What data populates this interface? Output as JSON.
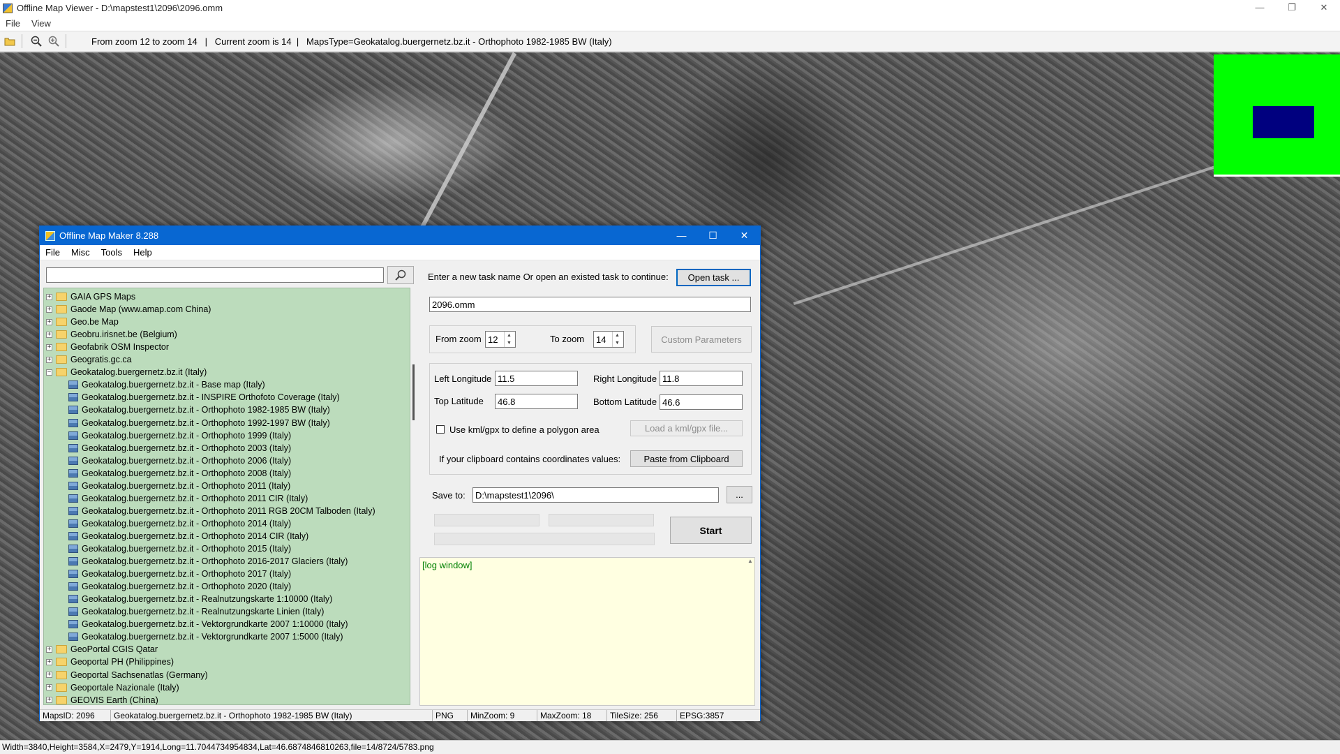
{
  "viewer": {
    "title": "Offline Map Viewer - D:\\mapstest1\\2096\\2096.omm",
    "menu": [
      "File",
      "View"
    ],
    "toolbar_info": "From zoom 12 to zoom 14   |   Current zoom is 14  |   MapsType=Geokatalog.buergernetz.bz.it - Orthophoto 1982-1985 BW (Italy)",
    "status": "Width=3840,Height=3584,X=2479,Y=1914,Long=11.7044734954834,Lat=46.6874846810263,file=14/8724/5783.png",
    "minimap_colors": {
      "background": "#00ff00",
      "viewport": "#00007f"
    }
  },
  "dialog": {
    "title": "Offline Map Maker 8.288",
    "menu": [
      "File",
      "Misc",
      "Tools",
      "Help"
    ],
    "search": {
      "value": "",
      "placeholder": ""
    },
    "tree": [
      {
        "label": "GAIA GPS Maps",
        "type": "folder",
        "expanded": false
      },
      {
        "label": "Gaode Map (www.amap.com China)",
        "type": "folder",
        "expanded": false
      },
      {
        "label": "Geo.be Map",
        "type": "folder",
        "expanded": false
      },
      {
        "label": "Geobru.irisnet.be (Belgium)",
        "type": "folder",
        "expanded": false
      },
      {
        "label": "Geofabrik OSM Inspector",
        "type": "folder",
        "expanded": false
      },
      {
        "label": "Geogratis.gc.ca",
        "type": "folder",
        "expanded": false
      },
      {
        "label": "Geokatalog.buergernetz.bz.it (Italy)",
        "type": "folder",
        "expanded": true
      },
      {
        "label": "Geokatalog.buergernetz.bz.it - Base map (Italy)",
        "type": "map"
      },
      {
        "label": "Geokatalog.buergernetz.bz.it - INSPIRE Orthofoto Coverage (Italy)",
        "type": "map"
      },
      {
        "label": "Geokatalog.buergernetz.bz.it - Orthophoto 1982-1985 BW (Italy)",
        "type": "map",
        "selected": true
      },
      {
        "label": "Geokatalog.buergernetz.bz.it - Orthophoto 1992-1997 BW (Italy)",
        "type": "map"
      },
      {
        "label": "Geokatalog.buergernetz.bz.it - Orthophoto 1999 (Italy)",
        "type": "map"
      },
      {
        "label": "Geokatalog.buergernetz.bz.it - Orthophoto 2003 (Italy)",
        "type": "map"
      },
      {
        "label": "Geokatalog.buergernetz.bz.it - Orthophoto 2006 (Italy)",
        "type": "map"
      },
      {
        "label": "Geokatalog.buergernetz.bz.it - Orthophoto 2008 (Italy)",
        "type": "map"
      },
      {
        "label": "Geokatalog.buergernetz.bz.it - Orthophoto 2011 (Italy)",
        "type": "map"
      },
      {
        "label": "Geokatalog.buergernetz.bz.it - Orthophoto 2011 CIR (Italy)",
        "type": "map"
      },
      {
        "label": "Geokatalog.buergernetz.bz.it - Orthophoto 2011 RGB 20CM Talboden (Italy)",
        "type": "map"
      },
      {
        "label": "Geokatalog.buergernetz.bz.it - Orthophoto 2014 (Italy)",
        "type": "map"
      },
      {
        "label": "Geokatalog.buergernetz.bz.it - Orthophoto 2014 CIR (Italy)",
        "type": "map"
      },
      {
        "label": "Geokatalog.buergernetz.bz.it - Orthophoto 2015 (Italy)",
        "type": "map"
      },
      {
        "label": "Geokatalog.buergernetz.bz.it - Orthophoto 2016-2017 Glaciers (Italy)",
        "type": "map"
      },
      {
        "label": "Geokatalog.buergernetz.bz.it - Orthophoto 2017 (Italy)",
        "type": "map"
      },
      {
        "label": "Geokatalog.buergernetz.bz.it - Orthophoto 2020 (Italy)",
        "type": "map"
      },
      {
        "label": "Geokatalog.buergernetz.bz.it - Realnutzungskarte 1:10000 (Italy)",
        "type": "map"
      },
      {
        "label": "Geokatalog.buergernetz.bz.it - Realnutzungskarte Linien (Italy)",
        "type": "map"
      },
      {
        "label": "Geokatalog.buergernetz.bz.it - Vektorgrundkarte 2007 1:10000 (Italy)",
        "type": "map"
      },
      {
        "label": "Geokatalog.buergernetz.bz.it - Vektorgrundkarte 2007 1:5000 (Italy)",
        "type": "map"
      },
      {
        "label": "GeoPortal CGIS Qatar",
        "type": "folder",
        "expanded": false
      },
      {
        "label": "Geoportal PH (Philippines)",
        "type": "folder",
        "expanded": false
      },
      {
        "label": "Geoportal Sachsenatlas (Germany)",
        "type": "folder",
        "expanded": false
      },
      {
        "label": "Geoportale Nazionale (Italy)",
        "type": "folder",
        "expanded": false
      },
      {
        "label": "GEOVIS Earth (China)",
        "type": "folder",
        "expanded": false
      }
    ],
    "task_prompt": "Enter a new task name Or open an existed task to continue:",
    "open_task_label": "Open task ...",
    "task_name": "2096.omm",
    "from_zoom_label": "From zoom",
    "from_zoom": "12",
    "to_zoom_label": "To zoom",
    "to_zoom": "14",
    "custom_params_label": "Custom Parameters",
    "left_lon_label": "Left Longitude",
    "left_lon": "11.5",
    "right_lon_label": "Right Longitude",
    "right_lon": "11.8",
    "top_lat_label": "Top Latitude",
    "top_lat": "46.8",
    "bottom_lat_label": "Bottom Latitude",
    "bottom_lat": "46.6",
    "kml_label": "Use kml/gpx to define a polygon area",
    "load_kml_label": "Load a kml/gpx file...",
    "clipboard_label": "If your clipboard contains coordinates values:",
    "paste_label": "Paste from Clipboard",
    "save_to_label": "Save to:",
    "save_to": "D:\\mapstest1\\2096\\",
    "browse_label": "...",
    "start_label": "Start",
    "log_text": "[log window]",
    "status": {
      "maps_id": "MapsID: 2096",
      "map_name": "Geokatalog.buergernetz.bz.it - Orthophoto 1982-1985 BW (Italy)",
      "format": "PNG",
      "min_zoom": "MinZoom: 9",
      "max_zoom": "MaxZoom: 18",
      "tile_size": "TileSize: 256",
      "epsg": "EPSG:3857"
    }
  }
}
